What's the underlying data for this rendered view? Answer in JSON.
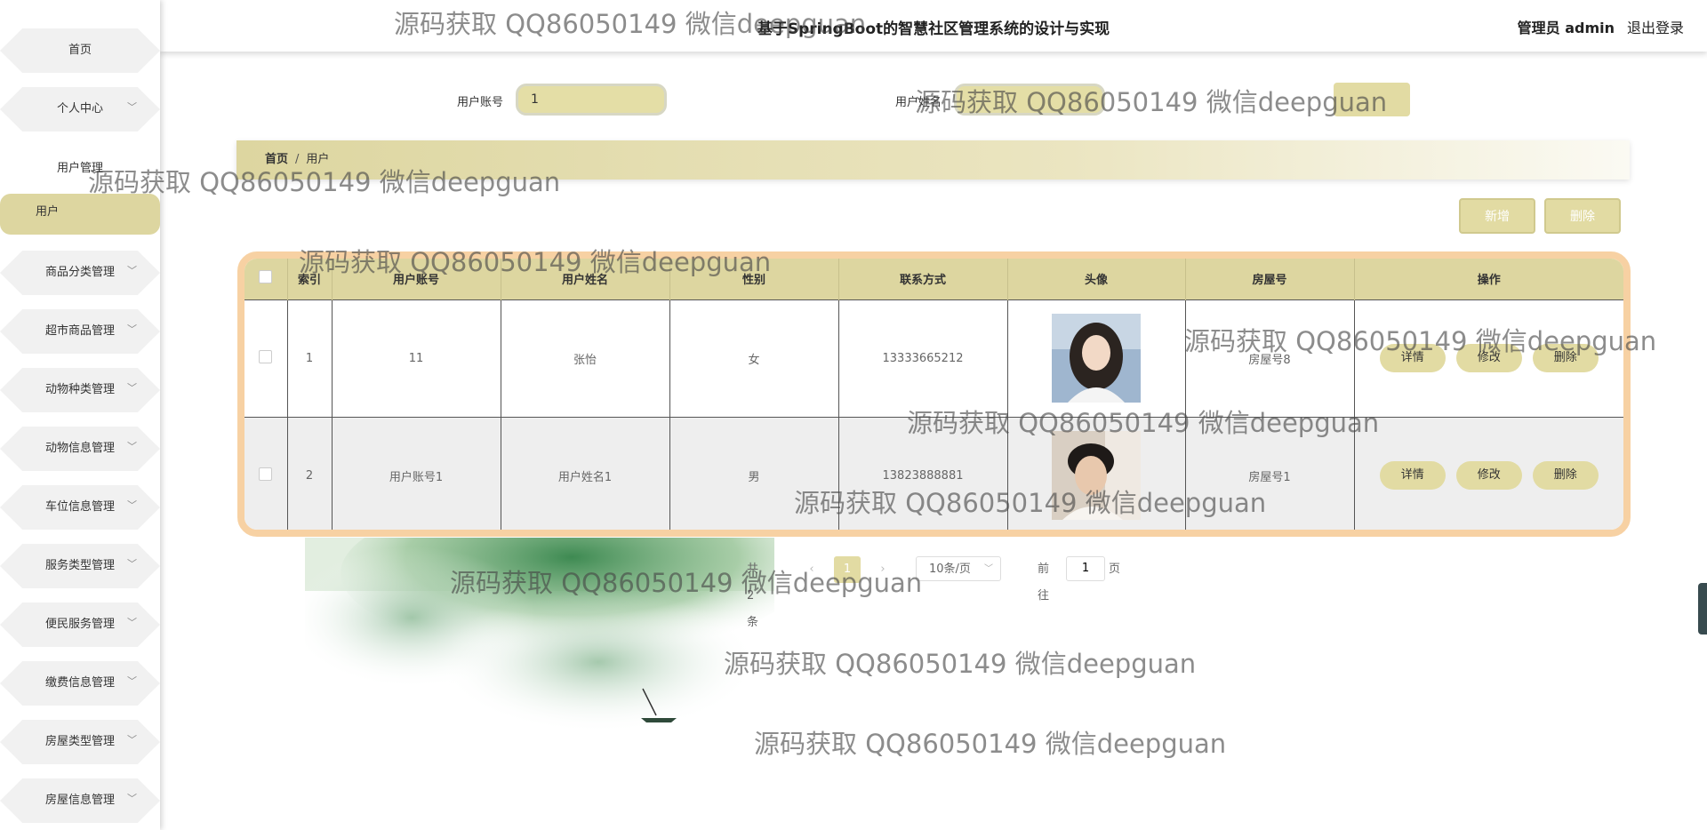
{
  "header": {
    "title": "基于SpringBoot的智慧社区管理系统的设计与实现",
    "user": "管理员 admin",
    "logout": "退出登录"
  },
  "sidebar": {
    "items": [
      {
        "label": "首页",
        "expandable": false
      },
      {
        "label": "个人中心",
        "expandable": true
      },
      {
        "label": "用户管理",
        "expandable": false
      },
      {
        "label": "用户",
        "expandable": false,
        "active": true
      },
      {
        "label": "商品分类管理",
        "expandable": true
      },
      {
        "label": "超市商品管理",
        "expandable": true
      },
      {
        "label": "动物种类管理",
        "expandable": true
      },
      {
        "label": "动物信息管理",
        "expandable": true
      },
      {
        "label": "车位信息管理",
        "expandable": true
      },
      {
        "label": "服务类型管理",
        "expandable": true
      },
      {
        "label": "便民服务管理",
        "expandable": true
      },
      {
        "label": "缴费信息管理",
        "expandable": true
      },
      {
        "label": "房屋类型管理",
        "expandable": true
      },
      {
        "label": "房屋信息管理",
        "expandable": true
      }
    ]
  },
  "search": {
    "account_label": "用户账号",
    "account_value": "1",
    "name_label": "用户姓名"
  },
  "breadcrumb": {
    "home": "首页",
    "sep": "/",
    "current": "用户"
  },
  "actions": {
    "add": "新增",
    "delete": "删除"
  },
  "table": {
    "headers": [
      "索引",
      "用户账号",
      "用户姓名",
      "性别",
      "联系方式",
      "头像",
      "房屋号",
      "操作"
    ],
    "rows": [
      {
        "index": "1",
        "account": "11",
        "name": "张怡",
        "gender": "女",
        "phone": "13333665212",
        "house": "房屋号8"
      },
      {
        "index": "2",
        "account": "用户账号1",
        "name": "用户姓名1",
        "gender": "男",
        "phone": "13823888881",
        "house": "房屋号1"
      }
    ],
    "ops": {
      "detail": "详情",
      "edit": "修改",
      "delete": "删除"
    }
  },
  "pagination": {
    "total": "共 2 条",
    "current_page": "1",
    "page_size": "10条/页",
    "goto_label": "前往",
    "goto_value": "1",
    "page_unit": "页"
  },
  "watermark": "源码获取 QQ86050149 微信deepguan",
  "colors": {
    "accent": "#ddd6a0",
    "table_border": "#f7d1a3",
    "button": "#e2dba3"
  }
}
